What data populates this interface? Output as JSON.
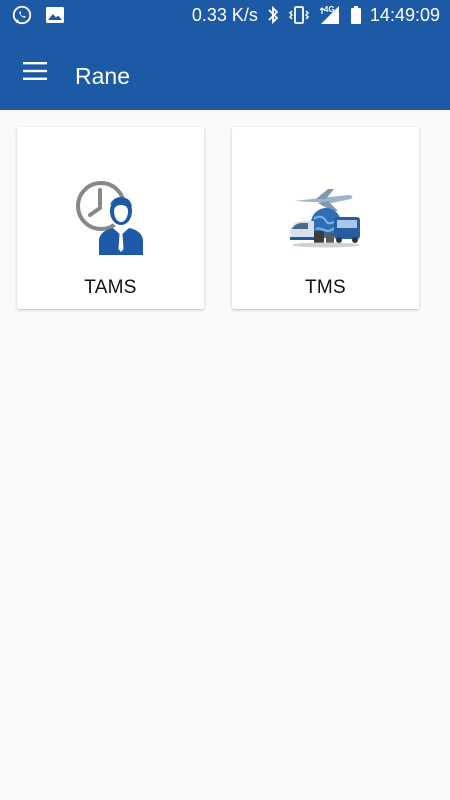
{
  "status_bar": {
    "speed": "0.33 K/s",
    "network": "4G",
    "time": "14:49:09",
    "icons": [
      "whatsapp-icon",
      "image-icon",
      "bluetooth-icon",
      "vibrate-icon",
      "signal-icon",
      "battery-icon"
    ]
  },
  "app_bar": {
    "title": "Rane",
    "menu_icon": "hamburger-menu-icon",
    "background": "#1d5aa5"
  },
  "modules": [
    {
      "label": "TAMS",
      "icon": "attendance-clock-person-icon"
    },
    {
      "label": "TMS",
      "icon": "travel-plane-train-icon"
    }
  ]
}
